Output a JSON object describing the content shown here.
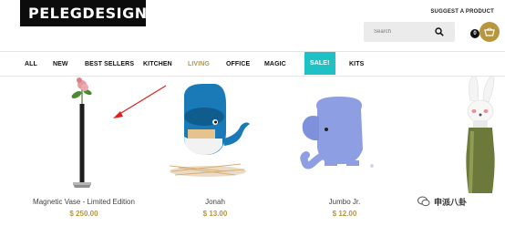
{
  "header": {
    "logo_text": "PELEGDESIGN",
    "logo_mark": "®",
    "suggest_label": "SUGGEST A PRODUCT",
    "search_placeholder": "Search",
    "cart_count": "0",
    "cart_icon": "basket-icon",
    "search_icon": "search-icon"
  },
  "nav": {
    "items": [
      {
        "label": "ALL"
      },
      {
        "label": "NEW"
      },
      {
        "label": "BEST SELLERS"
      },
      {
        "label": "KITCHEN"
      },
      {
        "label": "LIVING",
        "active": true
      },
      {
        "label": "OFFICE"
      },
      {
        "label": "MAGIC"
      },
      {
        "label": "SALE!",
        "highlight": true
      },
      {
        "label": "KITS"
      }
    ]
  },
  "products": [
    {
      "name": "Magnetic Vase - Limited Edition",
      "price": "$ 250.00"
    },
    {
      "name": "Jonah",
      "price": "$ 13.00"
    },
    {
      "name": "Jumbo Jr.",
      "price": "$ 12.00"
    },
    {
      "name": "",
      "price": ""
    }
  ],
  "watermark": {
    "text": "申派八卦"
  },
  "colors": {
    "accent": "#b8963e",
    "sale": "#1fc2c4",
    "arrow": "#e02020"
  }
}
